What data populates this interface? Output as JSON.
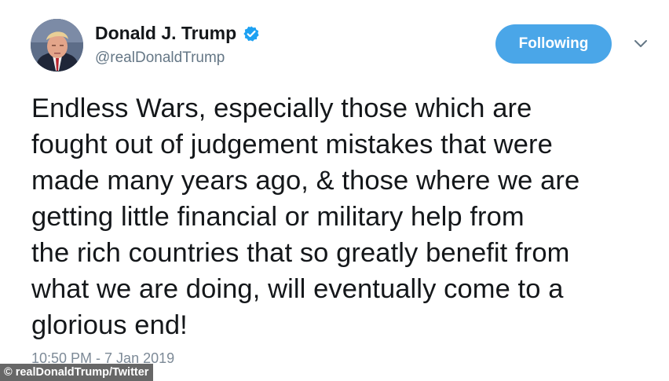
{
  "author": {
    "name": "Donald J. Trump",
    "handle": "@realDonaldTrump",
    "verified_icon": "verified-badge"
  },
  "follow_button": {
    "label": "Following",
    "color": "#4aa6e8"
  },
  "menu": {
    "icon": "chevron-down"
  },
  "tweet": {
    "lines": [
      "Endless Wars, especially those which are",
      "fought out of judgement mistakes that were",
      "made many years ago, & those where we are",
      "getting little financial or military help from",
      "the rich countries that so greatly benefit from",
      "what we are doing, will eventually come to a",
      "glorious end!"
    ],
    "timestamp": "10:50 PM - 7 Jan 2019"
  },
  "credit": {
    "text": "© realDonaldTrump/Twitter"
  }
}
